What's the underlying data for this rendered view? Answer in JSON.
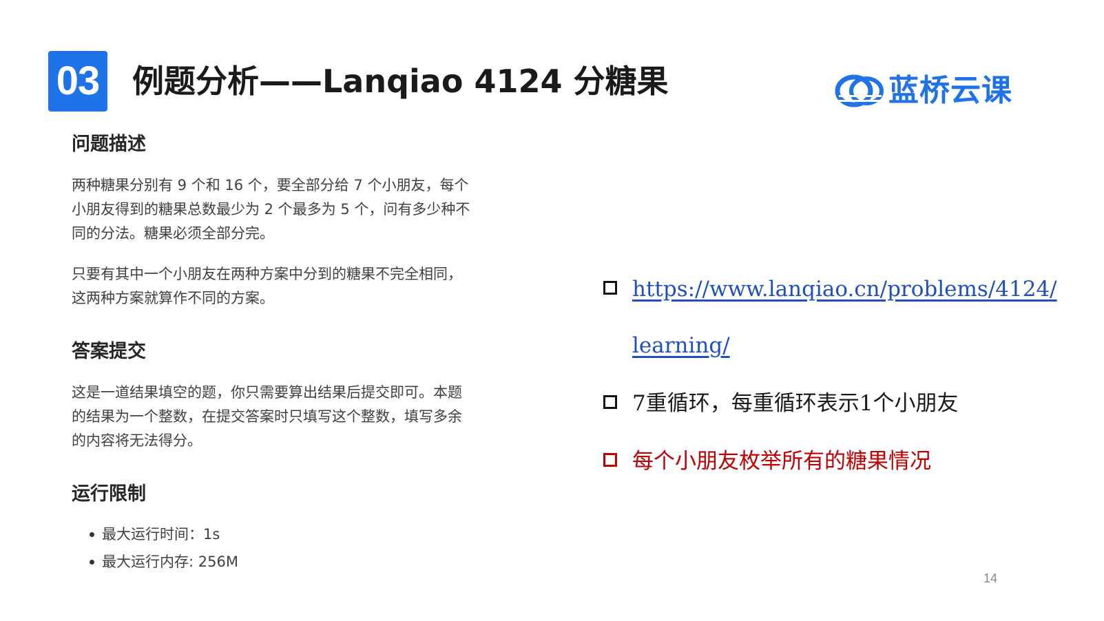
{
  "header": {
    "section_number": "03",
    "title": "例题分析——Lanqiao 4124 分糖果",
    "logo_text": "蓝桥云课"
  },
  "problem": {
    "heading_description": "问题描述",
    "description_lines": [
      "两种糖果分别有 9 个和 16 个，要全部分给 7 个小朋友，每个",
      "小朋友得到的糖果总数最少为 2 个最多为 5 个，问有多少种不",
      "同的分法。糖果必须全部分完。"
    ],
    "note_lines": [
      "只要有其中一个小朋友在两种方案中分到的糖果不完全相同，",
      "这两种方案就算作不同的方案。"
    ],
    "heading_submit": "答案提交",
    "submit_lines": [
      "这是一道结果填空的题，你只需要算出结果后提交即可。本题",
      "的结果为一个整数，在提交答案时只填写这个整数，填写多余",
      "的内容将无法得分。"
    ],
    "heading_limits": "运行限制",
    "limits": [
      "最大运行时间：1s",
      "最大运行内存: 256M"
    ]
  },
  "analysis": {
    "link_line1": "https://www.lanqiao.cn/problems/4124/",
    "link_line2": "learning/",
    "point1": "7重循环，每重循环表示1个小朋友",
    "point2": "每个小朋友枚举所有的糖果情况"
  },
  "colors": {
    "accent_blue": "#1f73e8",
    "highlight_red": "#c00000",
    "link_blue": "#1f4fbf"
  },
  "page_number": "14"
}
